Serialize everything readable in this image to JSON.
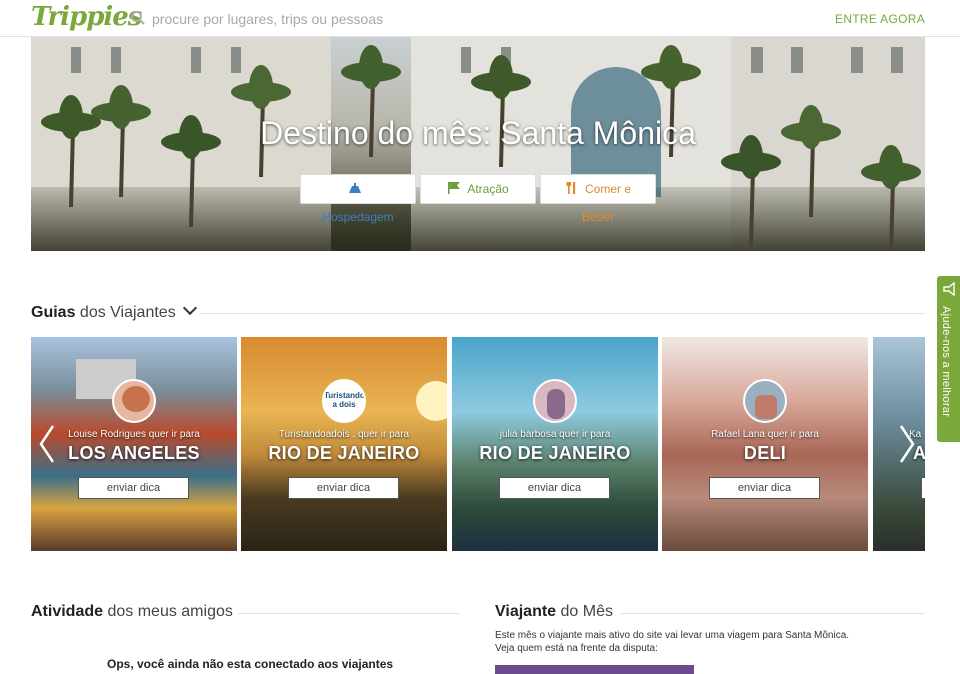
{
  "header": {
    "logo": "Trippies",
    "search_placeholder": "procure por lugares, trips ou pessoas",
    "login_label": "ENTRE AGORA"
  },
  "hero": {
    "title": "Destino do mês: Santa Mônica",
    "buttons": [
      {
        "label": "Hospedagem",
        "icon": "bed-icon",
        "color": "#3a7fc1"
      },
      {
        "label": "Atração",
        "icon": "flag-icon",
        "color": "#6aa13a"
      },
      {
        "label": "Comer e Beber",
        "icon": "fork-knife-icon",
        "color": "#e08a2a"
      }
    ]
  },
  "guides": {
    "title_bold": "Guias",
    "title_rest": "dos Viajantes",
    "cards": [
      {
        "user_text": "Louise Rodrigues quer ir para",
        "city": "LOS ANGELES",
        "button": "enviar dica"
      },
      {
        "user_text": "Turistandoadois . quer ir para",
        "city": "RIO DE JANEIRO",
        "button": "enviar dica",
        "avatar_text": "Turistando a dois"
      },
      {
        "user_text": "julia barbosa quer ir para",
        "city": "RIO DE JANEIRO",
        "button": "enviar dica"
      },
      {
        "user_text": "Rafael Lana quer ir para",
        "city": "DELI",
        "button": "enviar dica"
      },
      {
        "user_text": "Ka",
        "city": "A"
      }
    ]
  },
  "feedback_tab": {
    "label": "Ajude-nos a melhorar",
    "color": "#7aa83a"
  },
  "activity": {
    "title_bold": "Atividade",
    "title_rest": "dos meus amigos",
    "message": "Ops, você ainda não esta conectado aos viajantes"
  },
  "traveler": {
    "title_bold": "Viajante",
    "title_rest": "do Mês",
    "line1": "Este mês o viajante mais ativo do site vai levar uma viagem para Santa Mônica.",
    "line2": "Veja quem está na frente da disputa:"
  },
  "colors": {
    "brand": "#7aa83a"
  }
}
